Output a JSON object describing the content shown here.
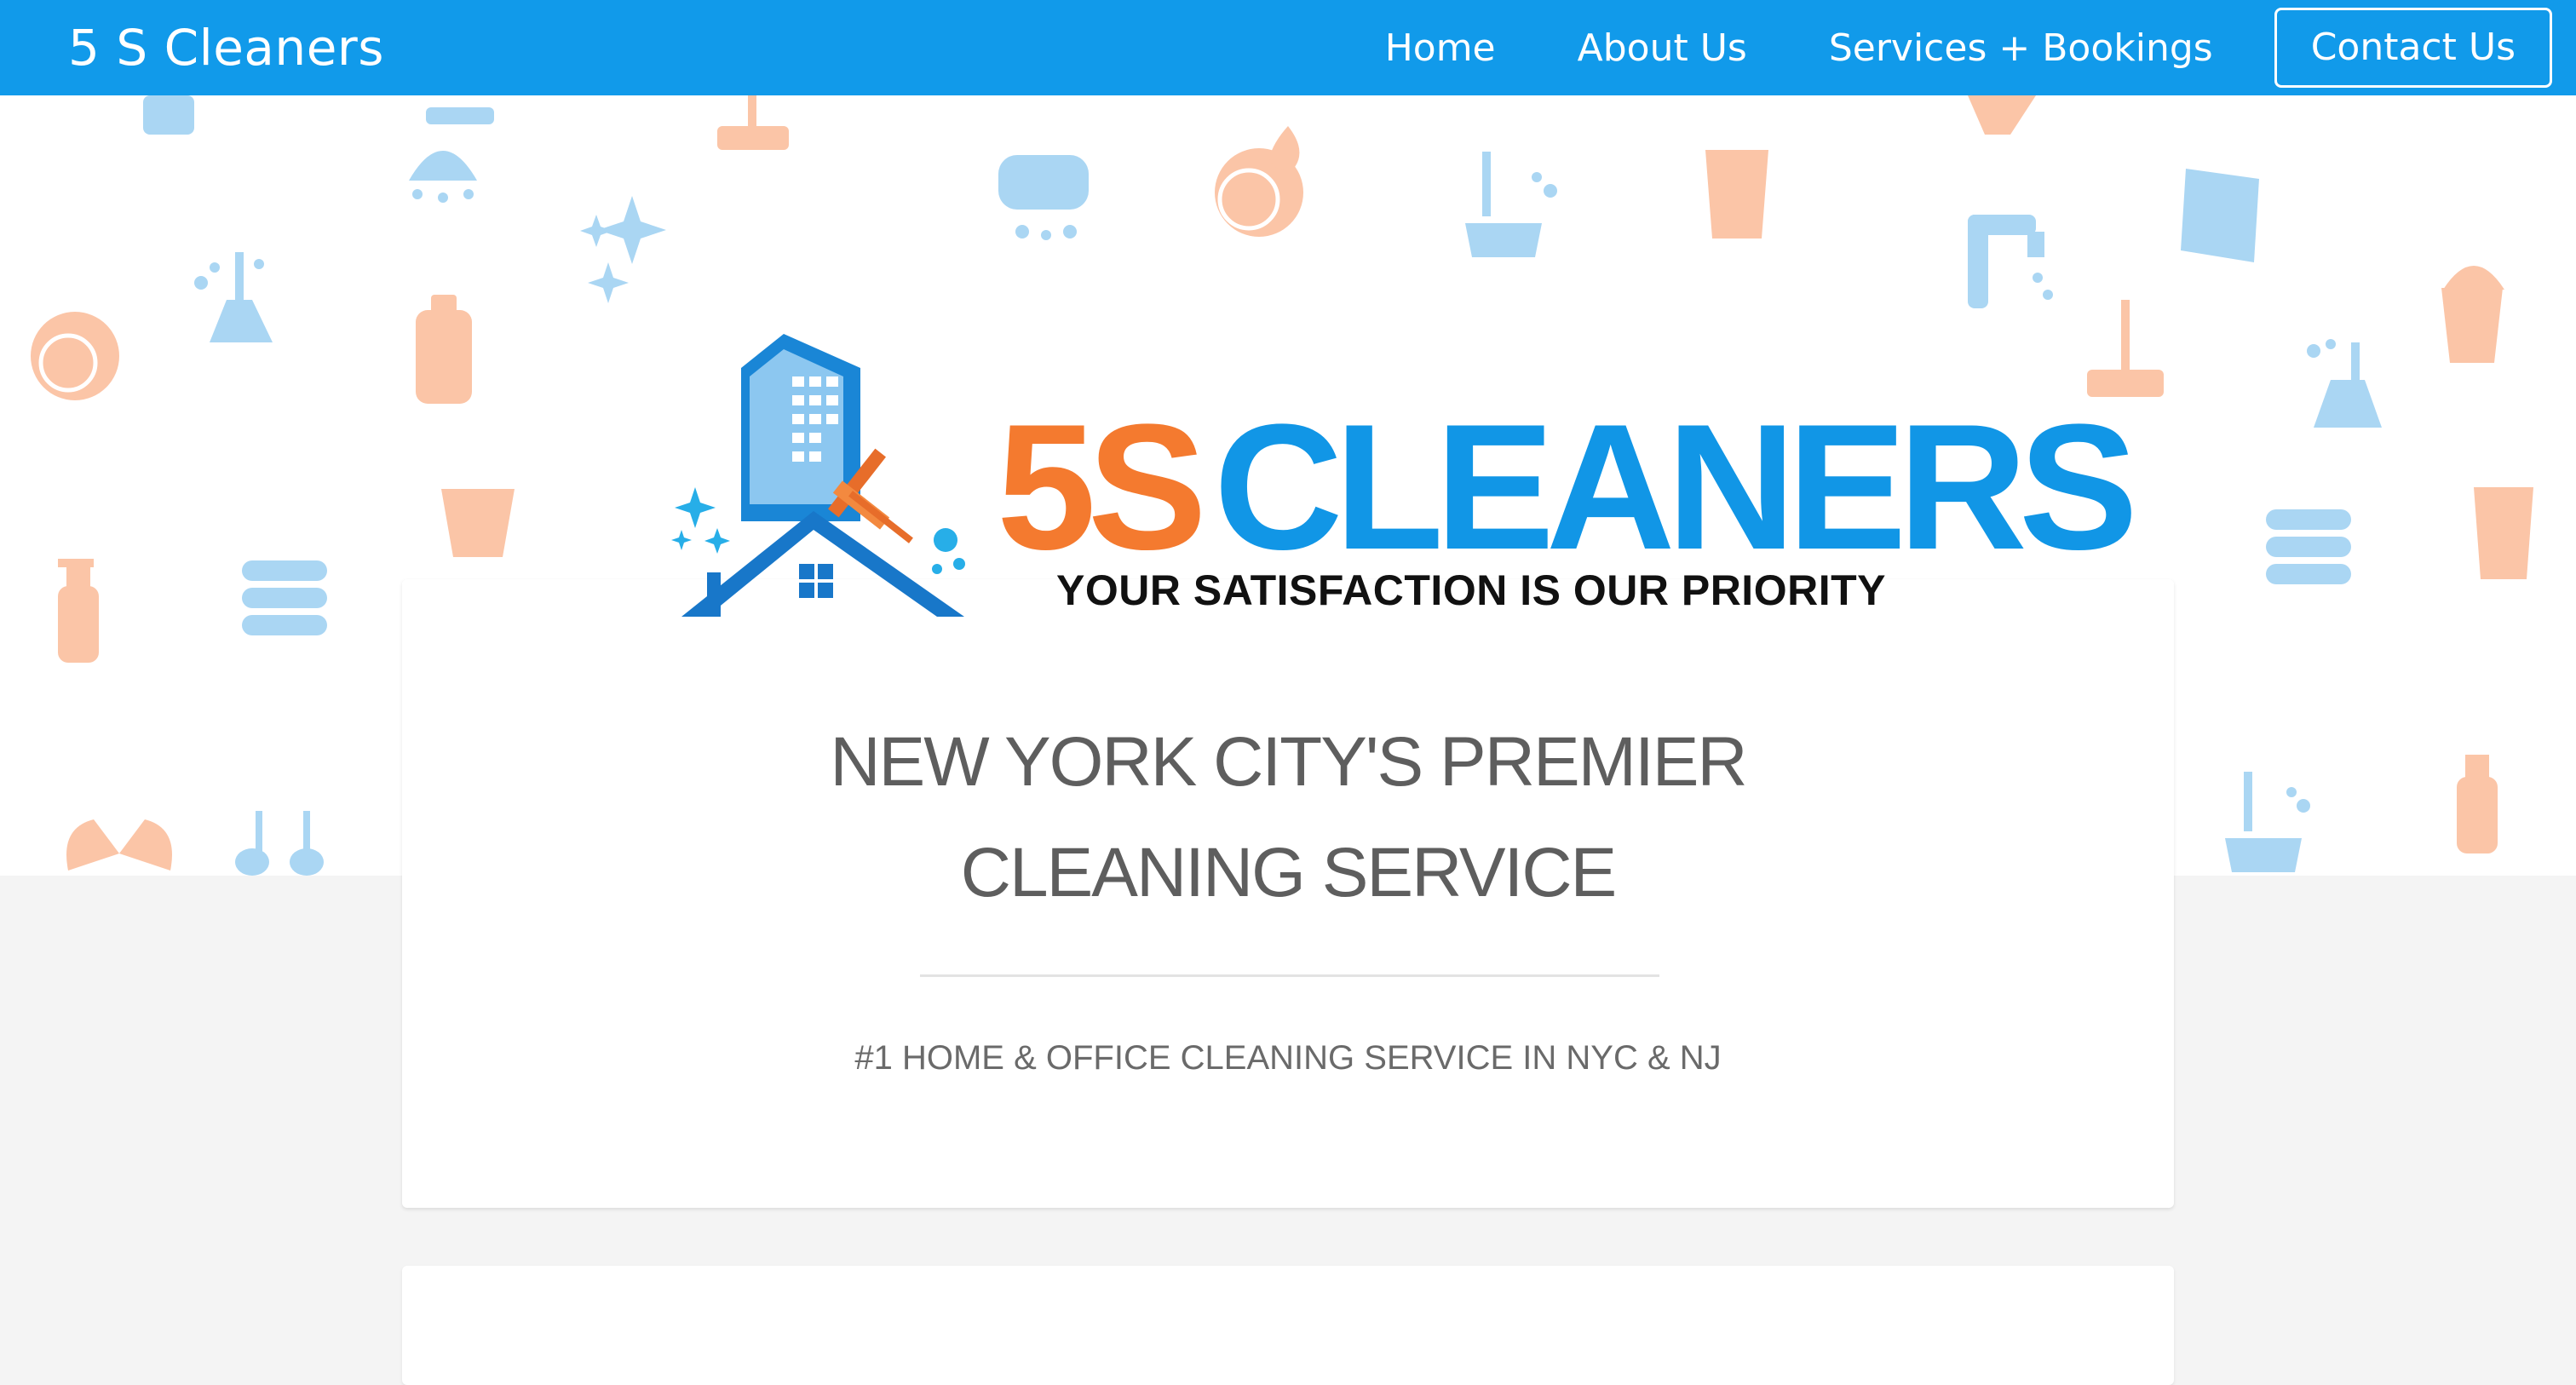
{
  "nav": {
    "brand": "5 S Cleaners",
    "links": [
      "Home",
      "About Us",
      "Services + Bookings"
    ],
    "contact": "Contact Us"
  },
  "logo": {
    "part1": "5S",
    "part2": "CLEANERS",
    "tagline": "YOUR SATISFACTION IS OUR PRIORITY"
  },
  "hero": {
    "title_line1": "NEW YORK CITY'S PREMIER",
    "title_line2": "CLEANING SERVICE",
    "subtitle": "#1 HOME & OFFICE CLEANING SERVICE IN NYC & NJ"
  },
  "colors": {
    "nav_blue": "#119aea",
    "logo_orange": "#f47a2f",
    "logo_blue": "#1196e6",
    "pattern_blue": "#aad6f3",
    "pattern_orange": "#fbc5a7"
  }
}
